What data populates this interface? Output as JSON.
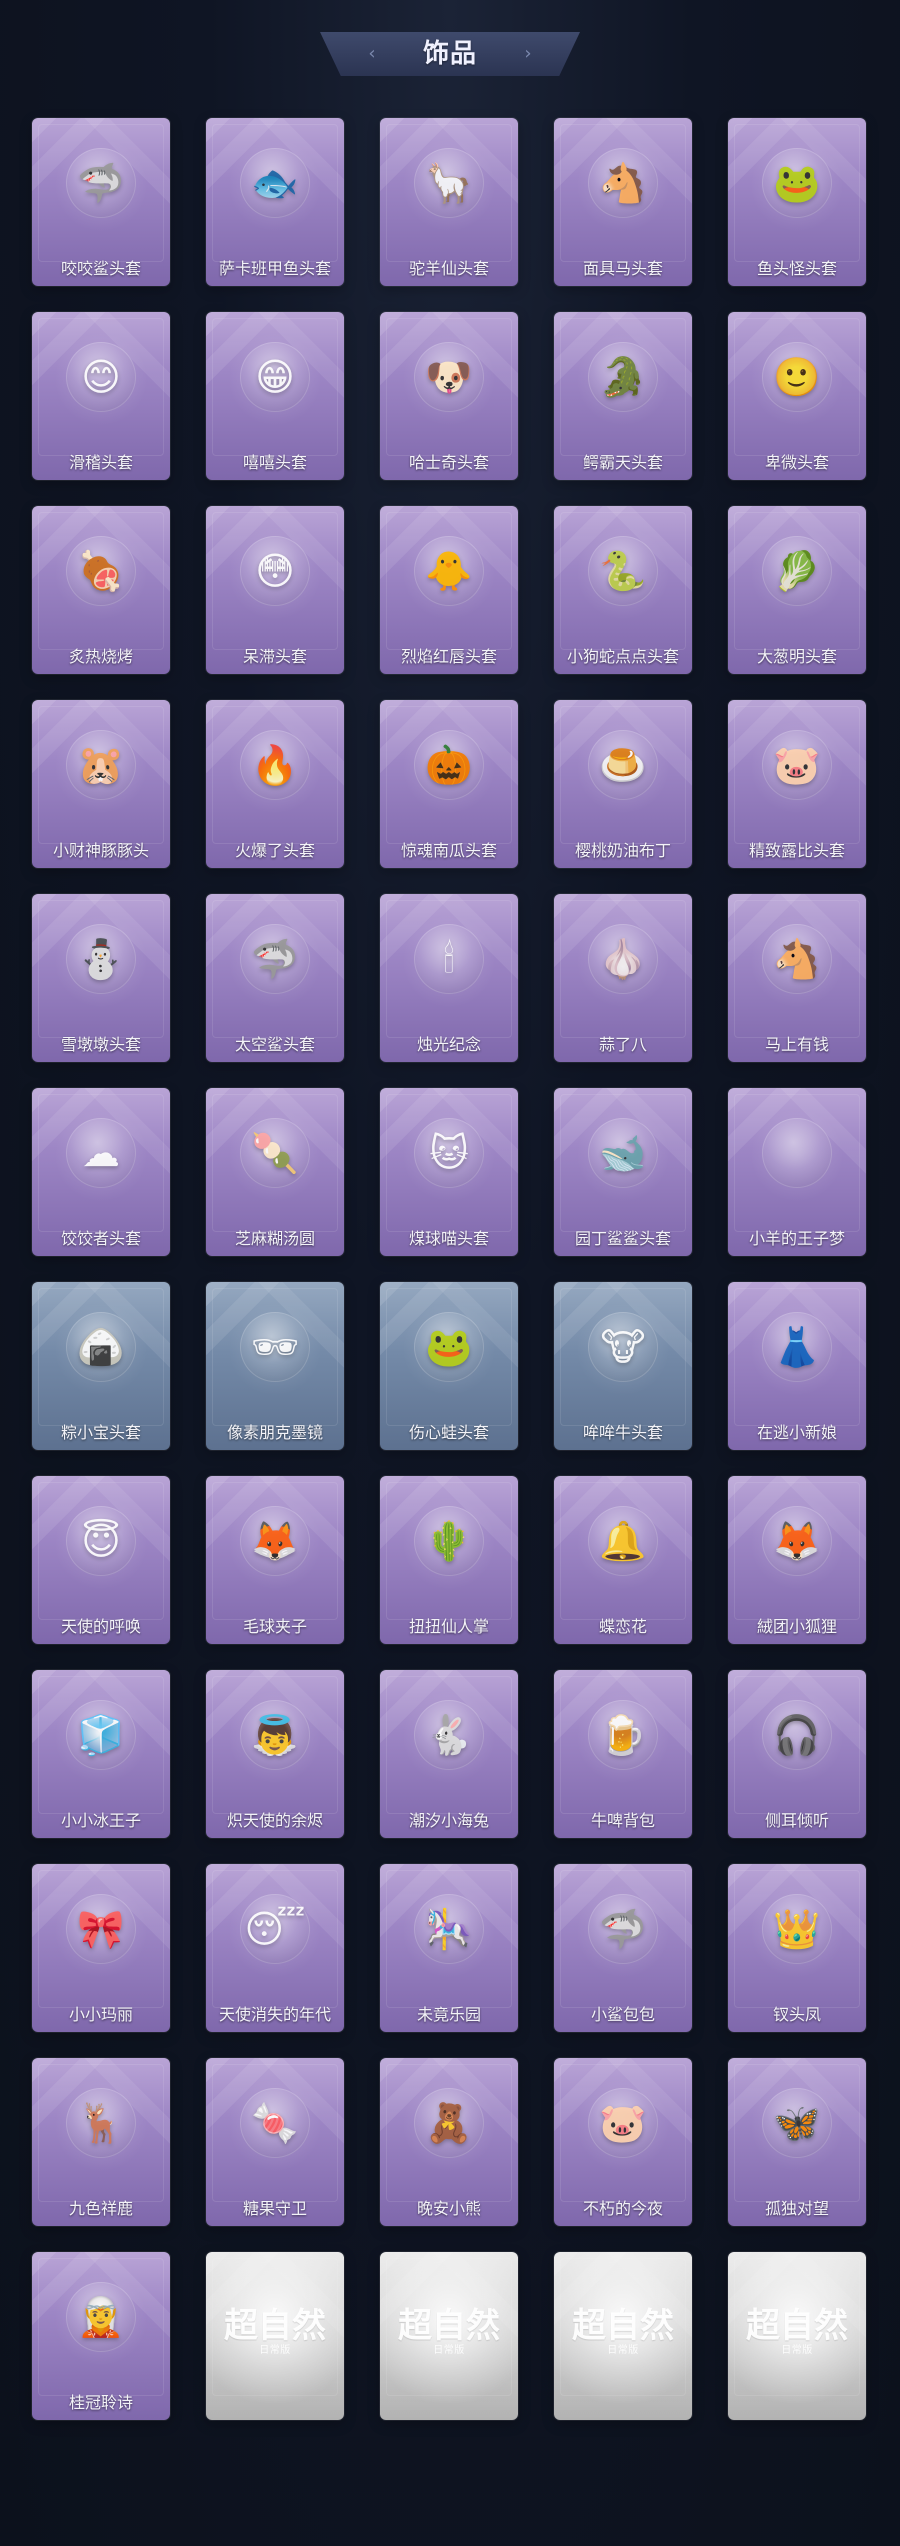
{
  "header": {
    "title": "饰品",
    "left_icon": "‹",
    "right_icon": "›"
  },
  "items": [
    {
      "label": "咬咬鲨头套",
      "icon": "🦈",
      "style": "purple"
    },
    {
      "label": "萨卡班甲鱼头套",
      "icon": "🐟",
      "style": "purple"
    },
    {
      "label": "驼羊仙头套",
      "icon": "🦙",
      "style": "purple"
    },
    {
      "label": "面具马头套",
      "icon": "🐴",
      "style": "purple"
    },
    {
      "label": "鱼头怪头套",
      "icon": "🐸",
      "style": "purple"
    },
    {
      "label": "滑稽头套",
      "icon": "😊",
      "style": "purple"
    },
    {
      "label": "嘻嘻头套",
      "icon": "😁",
      "style": "purple"
    },
    {
      "label": "哈士奇头套",
      "icon": "🐶",
      "style": "purple"
    },
    {
      "label": "鳄霸天头套",
      "icon": "🐊",
      "style": "purple"
    },
    {
      "label": "卑微头套",
      "icon": "🙂",
      "style": "purple"
    },
    {
      "label": "炙热烧烤",
      "icon": "🍖",
      "style": "purple"
    },
    {
      "label": "呆滞头套",
      "icon": "😳",
      "style": "purple"
    },
    {
      "label": "烈焰红唇头套",
      "icon": "🐥",
      "style": "purple"
    },
    {
      "label": "小狗蛇点点头套",
      "icon": "🐍",
      "style": "purple"
    },
    {
      "label": "大葱明头套",
      "icon": "🥬",
      "style": "purple"
    },
    {
      "label": "小财神豚豚头",
      "icon": "🐹",
      "style": "purple"
    },
    {
      "label": "火爆了头套",
      "icon": "🔥",
      "style": "purple"
    },
    {
      "label": "惊魂南瓜头套",
      "icon": "🎃",
      "style": "purple"
    },
    {
      "label": "樱桃奶油布丁",
      "icon": "🍮",
      "style": "purple"
    },
    {
      "label": "精致露比头套",
      "icon": "🐷",
      "style": "purple"
    },
    {
      "label": "雪墩墩头套",
      "icon": "⛄",
      "style": "purple"
    },
    {
      "label": "太空鲨头套",
      "icon": "🦈",
      "style": "purple"
    },
    {
      "label": "烛光纪念",
      "icon": "🕯",
      "style": "purple"
    },
    {
      "label": "蒜了八",
      "icon": "🧄",
      "style": "purple"
    },
    {
      "label": "马上有钱",
      "icon": "🐴",
      "style": "purple"
    },
    {
      "label": "饺饺者头套",
      "icon": "☁",
      "style": "purple"
    },
    {
      "label": "芝麻糊汤圆",
      "icon": "🍡",
      "style": "purple"
    },
    {
      "label": "煤球喵头套",
      "icon": "🐱",
      "style": "purple"
    },
    {
      "label": "园丁鲨鲨头套",
      "icon": "🐋",
      "style": "purple"
    },
    {
      "label": "小羊的王子梦",
      "icon": "",
      "style": "purple"
    },
    {
      "label": "粽小宝头套",
      "icon": "🍙",
      "style": "blue"
    },
    {
      "label": "像素朋克墨镜",
      "icon": "🕶",
      "style": "blue"
    },
    {
      "label": "伤心蛙头套",
      "icon": "🐸",
      "style": "blue"
    },
    {
      "label": "哞哞牛头套",
      "icon": "🐮",
      "style": "blue"
    },
    {
      "label": "在逃小新娘",
      "icon": "👗",
      "style": "purple"
    },
    {
      "label": "天使的呼唤",
      "icon": "😇",
      "style": "purple"
    },
    {
      "label": "毛球夹子",
      "icon": "🦊",
      "style": "purple"
    },
    {
      "label": "扭扭仙人掌",
      "icon": "🌵",
      "style": "purple"
    },
    {
      "label": "蝶恋花",
      "icon": "🔔",
      "style": "purple"
    },
    {
      "label": "絨团小狐狸",
      "icon": "🦊",
      "style": "purple"
    },
    {
      "label": "小小冰王子",
      "icon": "🧊",
      "style": "purple"
    },
    {
      "label": "炽天使的余烬",
      "icon": "👼",
      "style": "purple"
    },
    {
      "label": "潮汐小海兔",
      "icon": "🐇",
      "style": "purple"
    },
    {
      "label": "牛啤背包",
      "icon": "🍺",
      "style": "purple"
    },
    {
      "label": "侧耳倾听",
      "icon": "🎧",
      "style": "purple"
    },
    {
      "label": "小小玛丽",
      "icon": "🎀",
      "style": "purple"
    },
    {
      "label": "天使消失的年代",
      "icon": "😴",
      "style": "purple"
    },
    {
      "label": "未竟乐园",
      "icon": "🎠",
      "style": "purple"
    },
    {
      "label": "小鲨包包",
      "icon": "🦈",
      "style": "purple"
    },
    {
      "label": "钗头凤",
      "icon": "👑",
      "style": "purple"
    },
    {
      "label": "九色祥鹿",
      "icon": "🦌",
      "style": "purple"
    },
    {
      "label": "糖果守卫",
      "icon": "🍬",
      "style": "purple"
    },
    {
      "label": "晚安小熊",
      "icon": "🧸",
      "style": "purple"
    },
    {
      "label": "不朽的今夜",
      "icon": "🐷",
      "style": "purple"
    },
    {
      "label": "孤独对望",
      "icon": "🦋",
      "style": "purple"
    },
    {
      "label": "桂冠聆诗",
      "icon": "🧝",
      "style": "purple"
    },
    {
      "label": "超自然",
      "icon": "超自然",
      "style": "locked",
      "subtext": "日常版"
    },
    {
      "label": "超自然",
      "icon": "超自然",
      "style": "locked",
      "subtext": "日常版"
    },
    {
      "label": "超自然",
      "icon": "超自然",
      "style": "locked",
      "subtext": "日常版"
    },
    {
      "label": "超自然",
      "icon": "超自然",
      "style": "locked",
      "subtext": "日常版"
    }
  ]
}
